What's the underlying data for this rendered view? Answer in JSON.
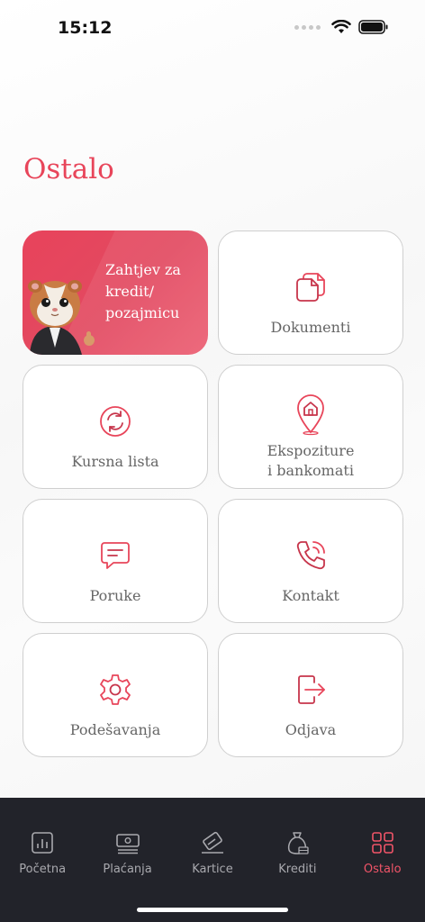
{
  "status_bar": {
    "time": "15:12"
  },
  "page": {
    "title": "Ostalo"
  },
  "promo": {
    "text": "Zahtjev za kredit/ pozajmicu"
  },
  "tiles": [
    {
      "label": "Dokumenti",
      "icon": "documents-icon"
    },
    {
      "label": "Kursna lista",
      "icon": "exchange-rate-icon"
    },
    {
      "label": "Ekspoziture",
      "label2": "i bankomati",
      "icon": "location-pin-icon"
    },
    {
      "label": "Poruke",
      "icon": "message-icon"
    },
    {
      "label": "Kontakt",
      "icon": "phone-icon"
    },
    {
      "label": "Podešavanja",
      "icon": "settings-gear-icon"
    },
    {
      "label": "Odjava",
      "icon": "logout-icon"
    }
  ],
  "tab_bar": {
    "items": [
      {
        "label": "Početna",
        "icon": "chart-icon",
        "active": false
      },
      {
        "label": "Plaćanja",
        "icon": "payments-icon",
        "active": false
      },
      {
        "label": "Kartice",
        "icon": "card-icon",
        "active": false
      },
      {
        "label": "Krediti",
        "icon": "money-bag-icon",
        "active": false
      },
      {
        "label": "Ostalo",
        "icon": "grid-icon",
        "active": true
      }
    ]
  },
  "colors": {
    "accent": "#e8455a",
    "tab_bar_bg": "#22232a",
    "tab_inactive": "#a9a9ae"
  }
}
